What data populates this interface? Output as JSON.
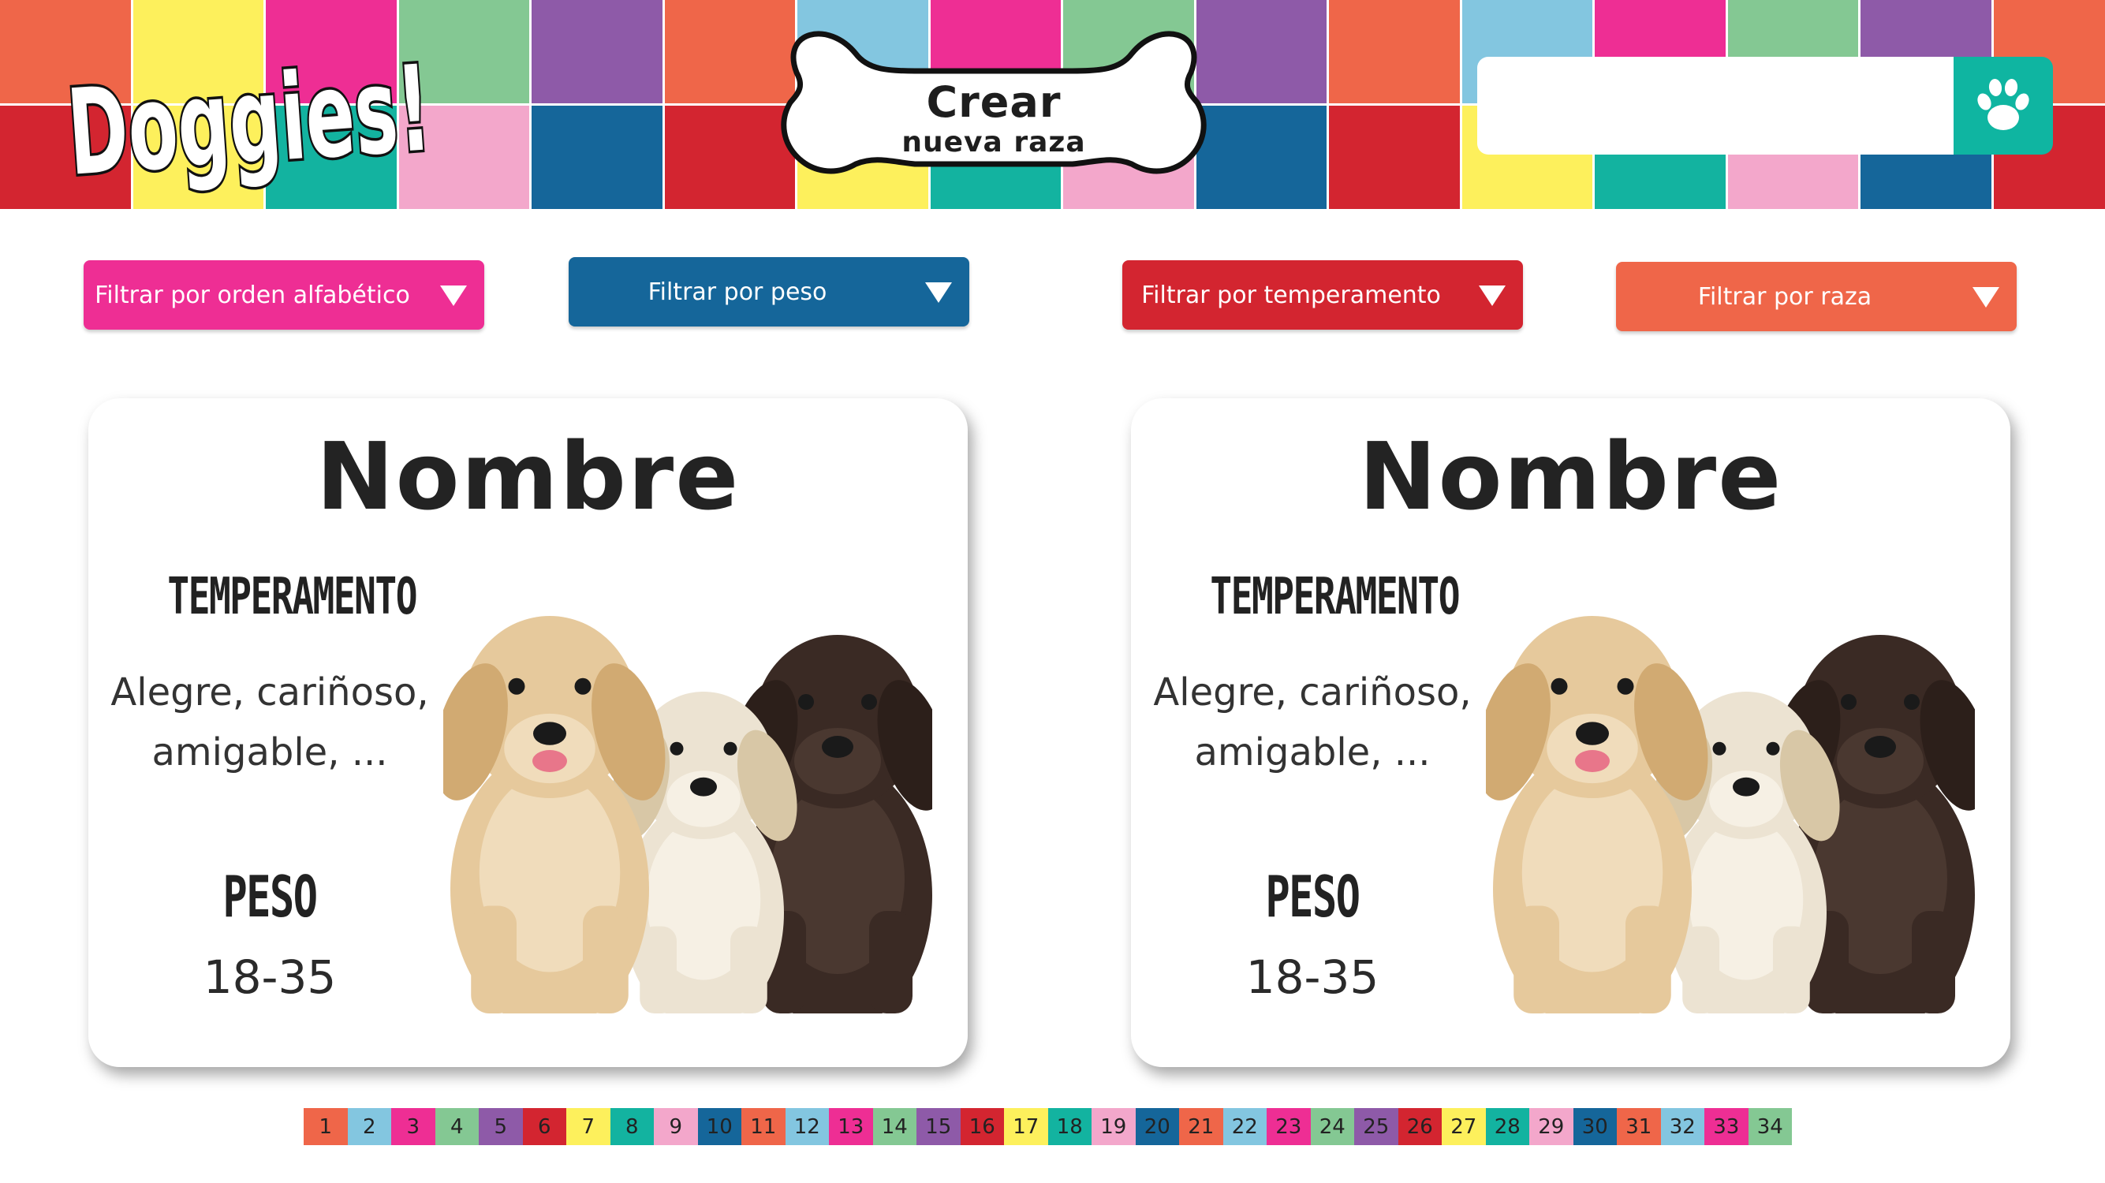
{
  "app": {
    "logo_text": "Doggies!"
  },
  "header": {
    "create_button_line1": "Crear",
    "create_button_line2": "nueva raza",
    "search": {
      "value": "",
      "placeholder": ""
    },
    "search_button_icon": "paw-icon",
    "palette": [
      "#ef6649",
      "#83c6e0",
      "#ee2e94",
      "#84c893",
      "#8e5aa8",
      "#d32530",
      "#fdf05c",
      "#13b3a0",
      "#f3a7cb",
      "#15669a"
    ]
  },
  "filters": [
    {
      "label": "Filtrar por orden alfabético",
      "color": "#ee2e94"
    },
    {
      "label": "Filtrar por peso",
      "color": "#15669a"
    },
    {
      "label": "Filtrar por temperamento",
      "color": "#d32530"
    },
    {
      "label": "Filtrar por raza",
      "color": "#ef6649"
    }
  ],
  "cards": [
    {
      "name": "Nombre",
      "temperament_heading": "TEMPERAMENTO",
      "temperament_line1": "Alegre, cariñoso,",
      "temperament_line2": "amigable, ...",
      "weight_heading": "PESO",
      "weight": "18-35"
    },
    {
      "name": "Nombre",
      "temperament_heading": "TEMPERAMENTO",
      "temperament_line1": "Alegre, cariñoso,",
      "temperament_line2": "amigable, ...",
      "weight_heading": "PESO",
      "weight": "18-35"
    }
  ],
  "pagination": {
    "pages": [
      "1",
      "2",
      "3",
      "4",
      "5",
      "6",
      "7",
      "8",
      "9",
      "10",
      "11",
      "12",
      "13",
      "14",
      "15",
      "16",
      "17",
      "18",
      "19",
      "20",
      "21",
      "22",
      "23",
      "24",
      "25",
      "26",
      "27",
      "28",
      "29",
      "30",
      "31",
      "32",
      "33",
      "34"
    ],
    "colors": [
      "#ef6649",
      "#83c6e0",
      "#ee2e94",
      "#84c893",
      "#8e5aa8",
      "#d32530",
      "#fdf05c",
      "#13b3a0",
      "#f3a7cb",
      "#15669a"
    ]
  }
}
